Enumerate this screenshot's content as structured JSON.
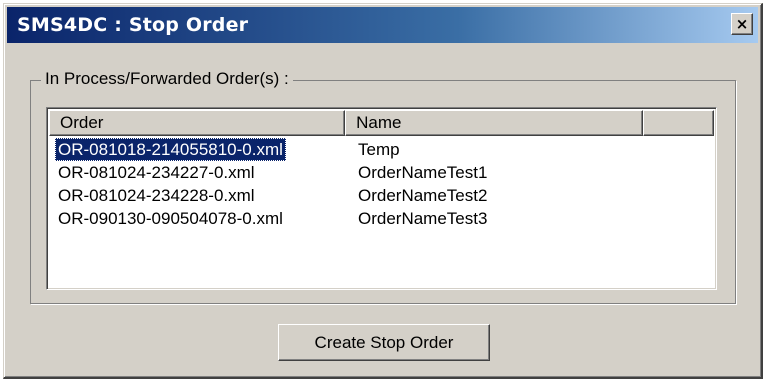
{
  "window": {
    "title": "SMS4DC : Stop Order",
    "close_label": "×"
  },
  "group": {
    "label": "In Process/Forwarded Order(s) :"
  },
  "list": {
    "columns": [
      "Order",
      "Name",
      ""
    ],
    "rows": [
      {
        "order": "OR-081018-214055810-0.xml",
        "name": "Temp",
        "selected": true
      },
      {
        "order": "OR-081024-234227-0.xml",
        "name": "OrderNameTest1",
        "selected": false
      },
      {
        "order": "OR-081024-234228-0.xml",
        "name": "OrderNameTest2",
        "selected": false
      },
      {
        "order": "OR-090130-090504078-0.xml",
        "name": "OrderNameTest3",
        "selected": false
      }
    ]
  },
  "buttons": {
    "create_stop_order": "Create Stop Order"
  },
  "colors": {
    "title_bar_start": "#0a246a",
    "title_bar_end": "#a6caf0",
    "selection": "#0a246a",
    "face": "#d4d0c8"
  },
  "icons": {
    "close": "close-icon"
  }
}
